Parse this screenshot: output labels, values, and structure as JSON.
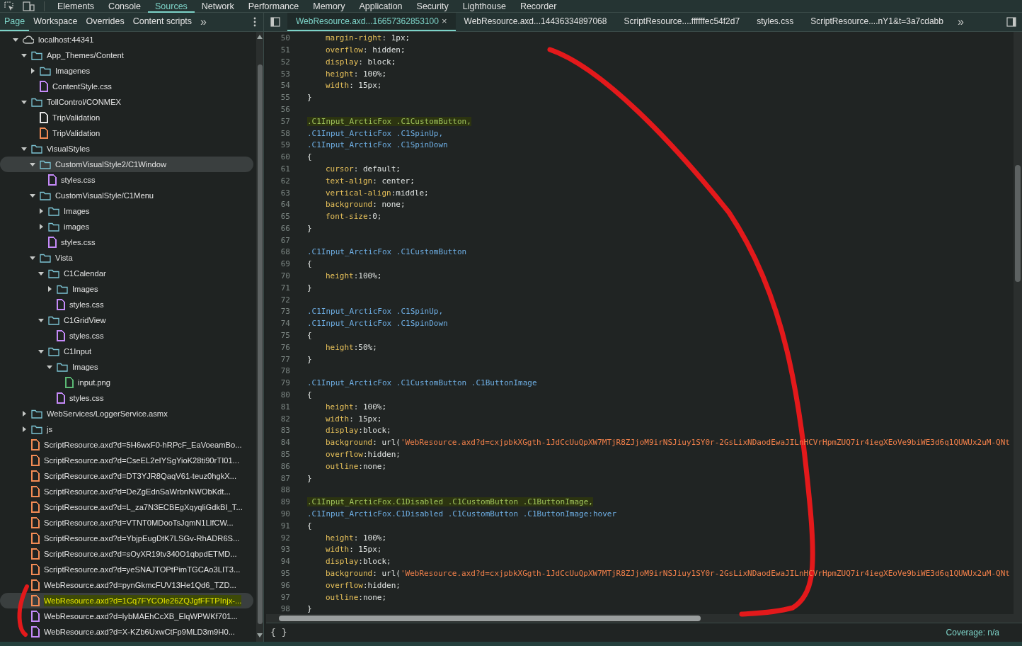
{
  "main_tabs": [
    {
      "label": "Elements",
      "selected": false
    },
    {
      "label": "Console",
      "selected": false
    },
    {
      "label": "Sources",
      "selected": true
    },
    {
      "label": "Network",
      "selected": false
    },
    {
      "label": "Performance",
      "selected": false
    },
    {
      "label": "Memory",
      "selected": false
    },
    {
      "label": "Application",
      "selected": false
    },
    {
      "label": "Security",
      "selected": false
    },
    {
      "label": "Lighthouse",
      "selected": false
    },
    {
      "label": "Recorder",
      "selected": false
    }
  ],
  "navigator": {
    "tabs": [
      {
        "label": "Page",
        "selected": true
      },
      {
        "label": "Workspace",
        "selected": false
      },
      {
        "label": "Overrides",
        "selected": false
      },
      {
        "label": "Content scripts",
        "selected": false
      }
    ],
    "more": "»",
    "tree": [
      {
        "kind": "domain",
        "label": "localhost:44341",
        "expanded": true,
        "selected": false,
        "children": [
          {
            "kind": "folder",
            "label": "App_Themes/Content",
            "expanded": true,
            "selected": false,
            "children": [
              {
                "kind": "folder",
                "label": "Imagenes",
                "expanded": false,
                "selected": false
              },
              {
                "kind": "file",
                "label": "ContentStyle.css",
                "color": "#c58af9",
                "selected": false
              }
            ]
          },
          {
            "kind": "folder",
            "label": "TollControl/CONMEX",
            "expanded": true,
            "selected": false,
            "children": [
              {
                "kind": "file",
                "label": "TripValidation",
                "color": "#e3e3e3",
                "selected": false
              },
              {
                "kind": "file",
                "label": "TripValidation",
                "color": "#f28b54",
                "selected": false
              }
            ]
          },
          {
            "kind": "folder",
            "label": "VisualStyles",
            "expanded": true,
            "selected": false,
            "children": [
              {
                "kind": "folder",
                "label": "CustomVisualStyle2/C1Window",
                "expanded": true,
                "selected": true,
                "children": [
                  {
                    "kind": "file",
                    "label": "styles.css",
                    "color": "#c58af9",
                    "selected": false
                  }
                ]
              },
              {
                "kind": "folder",
                "label": "CustomVisualStyle/C1Menu",
                "expanded": true,
                "selected": false,
                "children": [
                  {
                    "kind": "folder",
                    "label": "Images",
                    "expanded": false,
                    "selected": false
                  },
                  {
                    "kind": "folder",
                    "label": "images",
                    "expanded": false,
                    "selected": false
                  },
                  {
                    "kind": "file",
                    "label": "styles.css",
                    "color": "#c58af9",
                    "selected": false
                  }
                ]
              },
              {
                "kind": "folder",
                "label": "Vista",
                "expanded": true,
                "selected": false,
                "children": [
                  {
                    "kind": "folder",
                    "label": "C1Calendar",
                    "expanded": true,
                    "selected": false,
                    "children": [
                      {
                        "kind": "folder",
                        "label": "Images",
                        "expanded": false,
                        "selected": false
                      },
                      {
                        "kind": "file",
                        "label": "styles.css",
                        "color": "#c58af9",
                        "selected": false
                      }
                    ]
                  },
                  {
                    "kind": "folder",
                    "label": "C1GridView",
                    "expanded": true,
                    "selected": false,
                    "children": [
                      {
                        "kind": "file",
                        "label": "styles.css",
                        "color": "#c58af9",
                        "selected": false
                      }
                    ]
                  },
                  {
                    "kind": "folder",
                    "label": "C1Input",
                    "expanded": true,
                    "selected": false,
                    "children": [
                      {
                        "kind": "folder",
                        "label": "Images",
                        "expanded": true,
                        "selected": false,
                        "children": [
                          {
                            "kind": "file",
                            "label": "input.png",
                            "color": "#5bb974",
                            "selected": false
                          }
                        ]
                      },
                      {
                        "kind": "file",
                        "label": "styles.css",
                        "color": "#c58af9",
                        "selected": false
                      }
                    ]
                  }
                ]
              }
            ]
          },
          {
            "kind": "folder",
            "label": "WebServices/LoggerService.asmx",
            "expanded": false,
            "selected": false
          },
          {
            "kind": "folder",
            "label": "js",
            "expanded": false,
            "selected": false
          },
          {
            "kind": "file",
            "label": "ScriptResource.axd?d=5H6wxF0-hRPcF_EaVoeamBo...",
            "color": "#f28b54",
            "selected": false
          },
          {
            "kind": "file",
            "label": "ScriptResource.axd?d=CseEL2eIYSgYioK28ti90rTI01...",
            "color": "#f28b54",
            "selected": false
          },
          {
            "kind": "file",
            "label": "ScriptResource.axd?d=DT3YJR8QaqV61-teuz0hgkX...",
            "color": "#f28b54",
            "selected": false
          },
          {
            "kind": "file",
            "label": "ScriptResource.axd?d=DeZgEdnSaWrbnNWObKdt...",
            "color": "#f28b54",
            "selected": false
          },
          {
            "kind": "file",
            "label": "ScriptResource.axd?d=L_za7N3ECBEgXqyqliGdkBI_T...",
            "color": "#f28b54",
            "selected": false
          },
          {
            "kind": "file",
            "label": "ScriptResource.axd?d=VTNT0MDooTsJqmN1LlfCW...",
            "color": "#f28b54",
            "selected": false
          },
          {
            "kind": "file",
            "label": "ScriptResource.axd?d=YbjpEugDtK7LSGv-RhADR6S...",
            "color": "#f28b54",
            "selected": false
          },
          {
            "kind": "file",
            "label": "ScriptResource.axd?d=sOyXR19tv340O1qbpdETMD...",
            "color": "#f28b54",
            "selected": false
          },
          {
            "kind": "file",
            "label": "ScriptResource.axd?d=yeSNAJTOPtPimTGCAo3LIT3...",
            "color": "#f28b54",
            "selected": false
          },
          {
            "kind": "file",
            "label": "WebResource.axd?d=pynGkmcFUV13He1Qd6_TZD...",
            "color": "#f28b54",
            "selected": false
          },
          {
            "kind": "file",
            "label": "WebResource.axd?d=1Cq7FYCOIe26ZQJgfFFTPInjx-...",
            "color": "#f28b54",
            "selected": true,
            "highlighted": true
          },
          {
            "kind": "file",
            "label": "WebResource.axd?d=lybMAEhCcXB_ElqWPWKf701...",
            "color": "#c58af9",
            "selected": false
          },
          {
            "kind": "file",
            "label": "WebResource.axd?d=X-KZb6UxwCtFp9MLD3m9H0...",
            "color": "#c58af9",
            "selected": false
          }
        ]
      }
    ]
  },
  "editor": {
    "tabs": [
      {
        "label": "WebResource.axd...16657362853100",
        "selected": true,
        "close": "×"
      },
      {
        "label": "WebResource.axd...14436334897068",
        "selected": false
      },
      {
        "label": "ScriptResource....ffffffec54f2d7",
        "selected": false
      },
      {
        "label": "styles.css",
        "selected": false
      },
      {
        "label": "ScriptResource....nY1&t=3a7cdabb",
        "selected": false
      }
    ],
    "more": "»",
    "lines": [
      {
        "number": "50",
        "kind": "decl",
        "property": "margin-right",
        "rest": ": 1px;"
      },
      {
        "number": "51",
        "kind": "decl",
        "property": "overflow",
        "rest": ": hidden;"
      },
      {
        "number": "52",
        "kind": "decl",
        "property": "display",
        "rest": ": block;"
      },
      {
        "number": "53",
        "kind": "decl",
        "property": "height",
        "rest": ": 100%;"
      },
      {
        "number": "54",
        "kind": "decl",
        "property": "width",
        "rest": ": 15px;"
      },
      {
        "number": "55",
        "kind": "brace",
        "text": "}"
      },
      {
        "number": "56",
        "kind": "blank"
      },
      {
        "number": "57",
        "kind": "selector",
        "text": ".C1Input_ArcticFox .C1CustomButton,",
        "highlighted": true
      },
      {
        "number": "58",
        "kind": "selector",
        "text": ".C1Input_ArcticFox .C1SpinUp,",
        "highlighted": false
      },
      {
        "number": "59",
        "kind": "selector",
        "text": ".C1Input_ArcticFox .C1SpinDown",
        "highlighted": false
      },
      {
        "number": "60",
        "kind": "brace",
        "text": "{"
      },
      {
        "number": "61",
        "kind": "decl",
        "property": "cursor",
        "rest": ": default;"
      },
      {
        "number": "62",
        "kind": "decl",
        "property": "text-align",
        "rest": ": center;"
      },
      {
        "number": "63",
        "kind": "decl",
        "property": "vertical-align",
        "rest": ":middle;"
      },
      {
        "number": "64",
        "kind": "decl",
        "property": "background",
        "rest": ": none;"
      },
      {
        "number": "65",
        "kind": "decl",
        "property": "font-size",
        "rest": ":0;"
      },
      {
        "number": "66",
        "kind": "brace",
        "text": "}"
      },
      {
        "number": "67",
        "kind": "blank"
      },
      {
        "number": "68",
        "kind": "selector",
        "text": ".C1Input_ArcticFox .C1CustomButton",
        "highlighted": false
      },
      {
        "number": "69",
        "kind": "brace",
        "text": "{"
      },
      {
        "number": "70",
        "kind": "decl",
        "property": "height",
        "rest": ":100%;"
      },
      {
        "number": "71",
        "kind": "brace",
        "text": "}"
      },
      {
        "number": "72",
        "kind": "blank"
      },
      {
        "number": "73",
        "kind": "selector",
        "text": ".C1Input_ArcticFox .C1SpinUp,",
        "highlighted": false
      },
      {
        "number": "74",
        "kind": "selector",
        "text": ".C1Input_ArcticFox .C1SpinDown",
        "highlighted": false
      },
      {
        "number": "75",
        "kind": "brace",
        "text": "{"
      },
      {
        "number": "76",
        "kind": "decl",
        "property": "height",
        "rest": ":50%;"
      },
      {
        "number": "77",
        "kind": "brace",
        "text": "}"
      },
      {
        "number": "78",
        "kind": "blank"
      },
      {
        "number": "79",
        "kind": "selector",
        "text": ".C1Input_ArcticFox .C1CustomButton .C1ButtonImage",
        "highlighted": false
      },
      {
        "number": "80",
        "kind": "brace",
        "text": "{"
      },
      {
        "number": "81",
        "kind": "decl",
        "property": "height",
        "rest": ": 100%;"
      },
      {
        "number": "82",
        "kind": "decl",
        "property": "width",
        "rest": ": 15px;"
      },
      {
        "number": "83",
        "kind": "decl",
        "property": "display",
        "rest": ":block;"
      },
      {
        "number": "84",
        "kind": "url",
        "property": "background",
        "rest": ": url(",
        "string": "'WebResource.axd?d=cxjpbkXGgth-1JdCcUuQpXW7MTjR8ZJjoM9irNSJiuy1SY0r-2GsLixNDaodEwaJILnHCVrHpmZUQ7ir4iegXEoVe9biWE3d6q1QUWUx2uM-QNt"
      },
      {
        "number": "85",
        "kind": "decl",
        "property": "overflow",
        "rest": ":hidden;"
      },
      {
        "number": "86",
        "kind": "decl",
        "property": "outline",
        "rest": ":none;"
      },
      {
        "number": "87",
        "kind": "brace",
        "text": "}"
      },
      {
        "number": "88",
        "kind": "blank"
      },
      {
        "number": "89",
        "kind": "selector",
        "text": ".C1Input_ArcticFox.C1Disabled .C1CustomButton .C1ButtonImage,",
        "highlighted": true
      },
      {
        "number": "90",
        "kind": "selector",
        "text": ".C1Input_ArcticFox.C1Disabled .C1CustomButton .C1ButtonImage:hover",
        "highlighted": false
      },
      {
        "number": "91",
        "kind": "brace",
        "text": "{"
      },
      {
        "number": "92",
        "kind": "decl",
        "property": "height",
        "rest": ": 100%;"
      },
      {
        "number": "93",
        "kind": "decl",
        "property": "width",
        "rest": ": 15px;"
      },
      {
        "number": "94",
        "kind": "decl",
        "property": "display",
        "rest": ":block;"
      },
      {
        "number": "95",
        "kind": "url",
        "property": "background",
        "rest": ": url(",
        "string": "'WebResource.axd?d=cxjpbkXGgth-1JdCcUuQpXW7MTjR8ZJjoM9irNSJiuy1SY0r-2GsLixNDaodEwaJILnHCVrHpmZUQ7ir4iegXEoVe9biWE3d6q1QUWUx2uM-QNt"
      },
      {
        "number": "96",
        "kind": "decl",
        "property": "overflow",
        "rest": ":hidden;"
      },
      {
        "number": "97",
        "kind": "decl",
        "property": "outline",
        "rest": ":none;"
      },
      {
        "number": "98",
        "kind": "brace",
        "text": "}"
      }
    ]
  },
  "status_bar": {
    "format_button": "{ }",
    "coverage": "Coverage: n/a"
  }
}
